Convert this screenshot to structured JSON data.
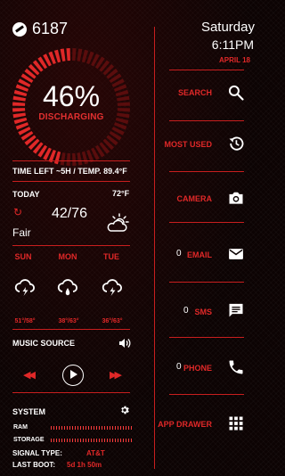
{
  "score": "6187",
  "battery": {
    "percent_label": "46%",
    "percent": 46,
    "status": "DISCHARGING",
    "time_temp": "TIME LEFT ~5H / TEMP. 89.4°F"
  },
  "weather": {
    "today_label": "TODAY",
    "current_temp": "72°F",
    "hi_lo": "42/76",
    "condition": "Fair",
    "forecast": [
      {
        "day": "SUN",
        "range": "51°/58°"
      },
      {
        "day": "MON",
        "range": "38°/63°"
      },
      {
        "day": "TUE",
        "range": "36°/63°"
      }
    ]
  },
  "music": {
    "label": "MUSIC SOURCE"
  },
  "system": {
    "label": "SYSTEM",
    "ram_label": "RAM",
    "storage_label": "STORAGE",
    "signal_label": "SIGNAL TYPE:",
    "signal_value": "AT&T",
    "boot_label": "LAST BOOT:",
    "boot_value": "5d 1h 50m"
  },
  "clock": {
    "day": "Saturday",
    "time": "6:11PM",
    "date": "APRIL 18"
  },
  "apps": [
    {
      "label": "SEARCH",
      "icon": "search-icon"
    },
    {
      "label": "MOST USED",
      "icon": "history-icon"
    },
    {
      "label": "CAMERA",
      "icon": "camera-icon"
    },
    {
      "label": "EMAIL",
      "count": "0",
      "icon": "mail-icon"
    },
    {
      "label": "SMS",
      "count": "0",
      "icon": "message-icon"
    },
    {
      "label": "PHONE",
      "count": "0",
      "icon": "phone-icon"
    },
    {
      "label": "APP DRAWER",
      "icon": "grid-icon"
    }
  ],
  "colors": {
    "accent": "#e02828",
    "background": "#0c0303",
    "text": "#ffffff"
  }
}
